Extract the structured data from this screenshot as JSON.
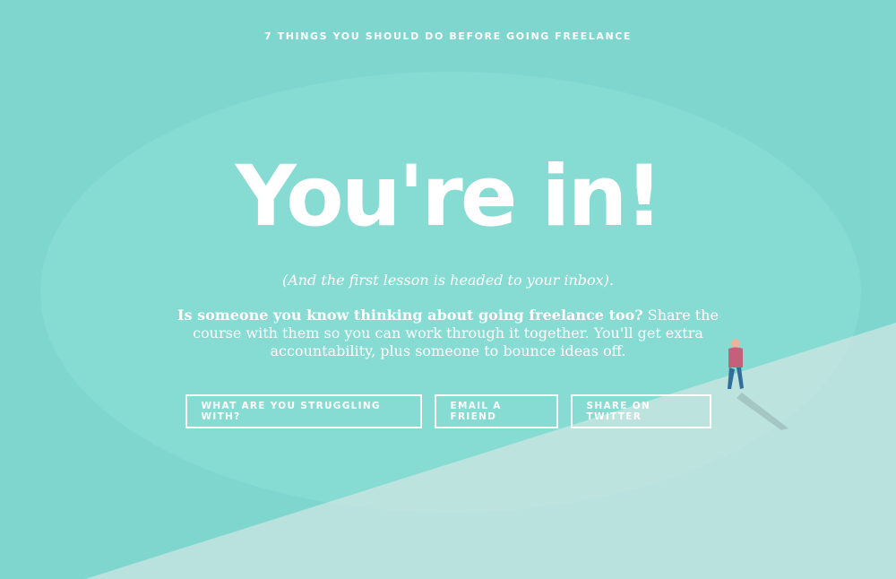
{
  "page": {
    "kicker": "7 THINGS YOU SHOULD DO BEFORE GOING FREELANCE",
    "headline": "You're in!",
    "subline": "(And the first lesson is headed to your inbox).",
    "body_lead": "Is someone you know thinking about going freelance too?",
    "body_rest": " Share the course with them so you can work through it together. You'll get extra accountability, plus someone to bounce ideas off."
  },
  "buttons": {
    "struggling": "WHAT ARE YOU STRUGGLING WITH?",
    "email": "EMAIL A FRIEND",
    "twitter": "SHARE ON TWITTER"
  },
  "colors": {
    "background": "#7fd6ce",
    "ellipse": "#86dbd3",
    "slope": "#b9e2de",
    "text": "#ffffff"
  },
  "illustration": {
    "figure": "person-walking-on-slope"
  }
}
